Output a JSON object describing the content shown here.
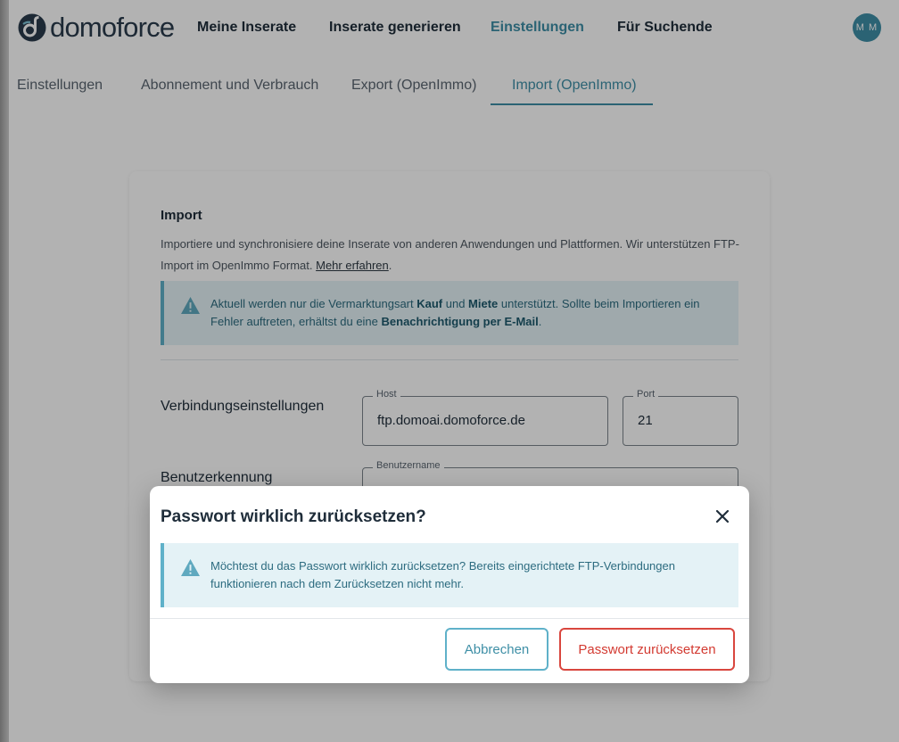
{
  "brand": {
    "name": "domoforce",
    "accent": "#3e8fa6",
    "danger": "#d33a31"
  },
  "nav": {
    "items": [
      {
        "label": "Meine Inserate"
      },
      {
        "label": "Inserate generieren"
      },
      {
        "label": "Einstellungen"
      },
      {
        "label": "Für Suchende"
      }
    ],
    "active": "Einstellungen",
    "avatar_initials": "M M"
  },
  "subnav": {
    "tabs": [
      {
        "label": "Einstellungen"
      },
      {
        "label": "Abonnement und Verbrauch"
      },
      {
        "label": "Export (OpenImmo)"
      },
      {
        "label": "Import (OpenImmo)"
      }
    ],
    "active": "Import (OpenImmo)"
  },
  "import": {
    "title": "Import",
    "description": "Importiere und synchronisiere deine Inserate von anderen Anwendungen und Plattformen. Wir unterstützen FTP-Import im OpenImmo Format.",
    "learn_more": "Mehr erfahren",
    "alert": {
      "p1": "Aktuell werden nur die Vermarktungsart ",
      "b1": "Kauf",
      "p2": " und ",
      "b2": "Miete",
      "p3": " unterstützt. Sollte beim Importieren ein Fehler auftreten, erhältst du eine ",
      "b3": "Benachrichtigung per E-Mail",
      "p4": "."
    },
    "connection_label": "Verbindungseinstellungen",
    "host_label": "Host",
    "host_value": "ftp.domoai.domoforce.de",
    "port_label": "Port",
    "port_value": "21",
    "user_label": "Benutzerkennung",
    "username_label": "Benutzername"
  },
  "modal": {
    "title": "Passwort wirklich zurücksetzen?",
    "alert_text": "Möchtest du das Passwort wirklich zurücksetzen? Bereits eingerichtete FTP-Verbindungen funktionieren nach dem Zurücksetzen nicht mehr.",
    "cancel_label": "Abbrechen",
    "confirm_label": "Passwort zurücksetzen"
  }
}
